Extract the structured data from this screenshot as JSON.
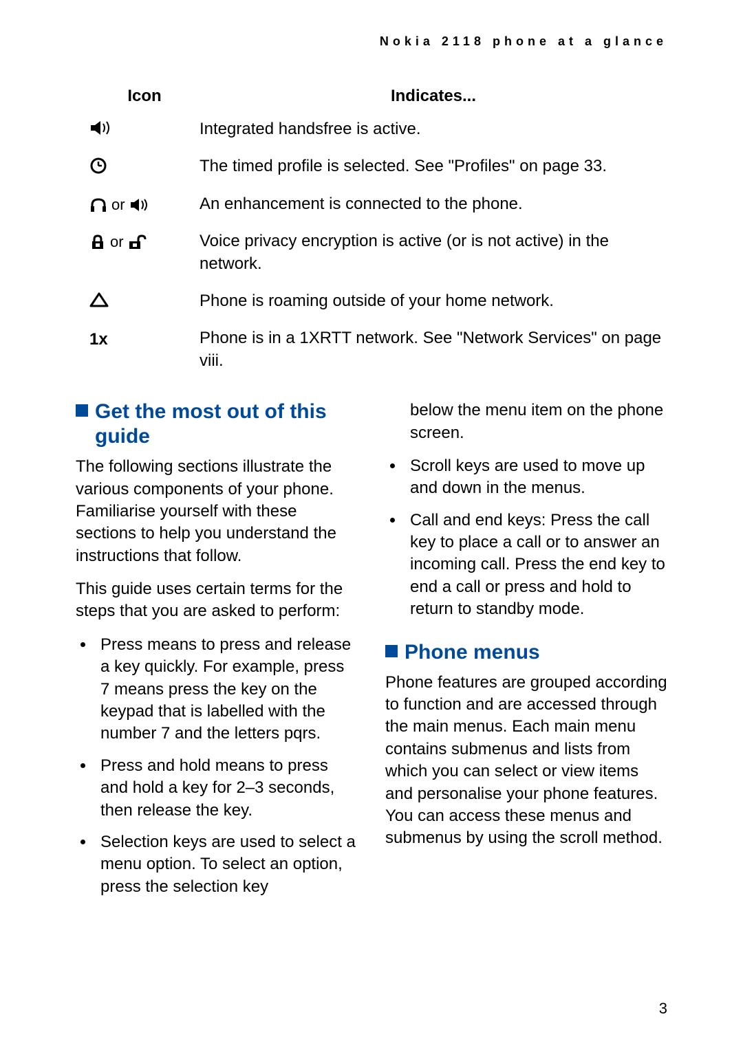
{
  "running_header": "Nokia 2118 phone at a glance",
  "table": {
    "head_icon": "Icon",
    "head_indicates": "Indicates...",
    "rows": [
      {
        "icon_label": "speaker-icon",
        "or": false,
        "text": "Integrated handsfree is active."
      },
      {
        "icon_label": "clock-icon",
        "or": false,
        "text": "The timed profile is selected. See \"Profiles\" on page 33."
      },
      {
        "icon_label": "headset-or-speaker-icon",
        "or": true,
        "or_word": "or",
        "text": "An enhancement is connected to the phone."
      },
      {
        "icon_label": "lock-closed-or-open-icon",
        "or": true,
        "or_word": "or",
        "text": "Voice privacy encryption is active (or is not active) in the network."
      },
      {
        "icon_label": "roaming-triangle-icon",
        "or": false,
        "text": "Phone is roaming outside of your home network."
      },
      {
        "icon_label": "one-x-icon",
        "or": false,
        "text": "Phone is in a 1XRTT network. See \"Network Services\" on page viii."
      }
    ]
  },
  "sections": {
    "guide_title": "Get the most out of this guide",
    "guide_p1": "The following sections illustrate the various components of your phone. Familiarise yourself with these sections to help you understand the instructions that follow.",
    "guide_p2": "This guide uses certain terms for the steps that you are asked to perform:",
    "guide_bullets": [
      "Press means to press and release a key quickly. For example, press 7 means press the key on the keypad that is labelled with the number 7 and the letters pqrs.",
      "Press and hold means to press and hold a key for 2–3 seconds, then release the key.",
      "Selection keys are used to select a menu option. To select an option, press the selection key"
    ],
    "col2_continuation": "below the menu item on the phone screen.",
    "col2_bullets": [
      "Scroll keys are used to move up and down in the menus.",
      "Call and end keys: Press the call key to place a call or to answer an incoming call. Press the end key to end a call or press and hold to return to standby mode."
    ],
    "menus_title": "Phone menus",
    "menus_p1": "Phone features are grouped according to function and are accessed through the main menus. Each main menu contains submenus and lists from which you can select or view items and personalise your phone features. You can access these menus and submenus by using the scroll method."
  },
  "page_number": "3"
}
